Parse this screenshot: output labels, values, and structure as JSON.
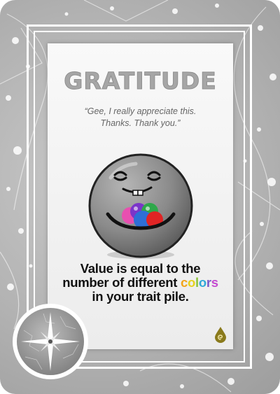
{
  "card": {
    "title": "GRATITUDE",
    "quote_lines": [
      "“Gee, I really appreciate this.",
      "Thanks. Thank you.”"
    ],
    "rule_line_1": "Value is equal to the",
    "rule_line_2_before": "number of different ",
    "rule_highlight_letters": [
      "c",
      "o",
      "l",
      "o",
      "r",
      "s"
    ],
    "rule_line_3": "in your trait pile."
  },
  "icons": {
    "mascot": "smiling-gray-ball-holding-colored-balls-icon",
    "trait": "swirl-drop-icon",
    "badge": "compass-star-icon"
  },
  "colors": {
    "card_background": "#b3b3b3",
    "title": "#a6a6a6",
    "mascot_body": "#8a8a8a",
    "held_balls": [
      "#e02424",
      "#2e6fd6",
      "#2ea84a",
      "#7b35c9",
      "#e84fb0"
    ],
    "rainbow": [
      "#f2a51a",
      "#e7d21c",
      "#8cc43c",
      "#2fa9d9",
      "#7a5bc9",
      "#c54ad0"
    ],
    "drop_icon": "#8a7a1c"
  }
}
